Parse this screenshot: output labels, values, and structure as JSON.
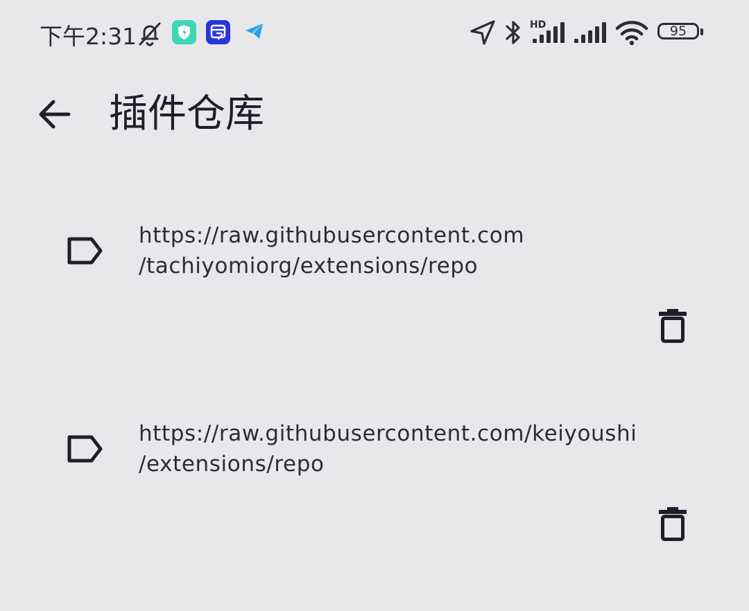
{
  "status_bar": {
    "time": "下午2:31",
    "network_label": "HD",
    "battery_level": "95"
  },
  "app_bar": {
    "title": "插件仓库"
  },
  "repos": [
    {
      "url_line1": "https://raw.githubusercontent.com",
      "url_line2": "/tachiyomiorg/extensions/repo"
    },
    {
      "url_line1": "https://raw.githubusercontent.com/keiyoushi",
      "url_line2": "/extensions/repo"
    }
  ],
  "colors": {
    "background": "#e8e8ea",
    "text": "#1d1f2a",
    "app_icon_shield": "#3dd6b6",
    "app_icon_blue": "#2a35d8",
    "telegram": "#2aa3e6"
  }
}
